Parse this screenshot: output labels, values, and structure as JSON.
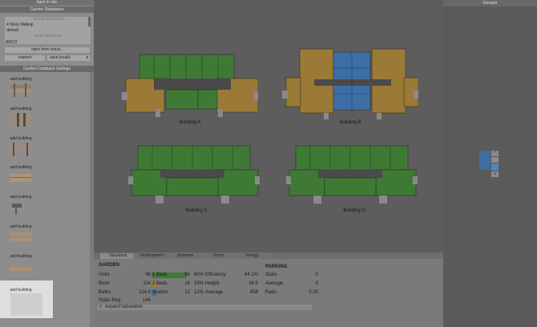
{
  "left_panel": {
    "back_label": "back to site",
    "garden_db_header": "Garden Databases",
    "databases": [
      "default databases",
      "4 Story Walkup",
      "default",
      "local databases"
    ],
    "arco_label": "ARCO",
    "open_cloud_label": "open from cloud...",
    "name_placeholder": "<name>",
    "save_select_value": "save locally",
    "settings_header": "Garden Database Settings",
    "tiles": [
      "add building",
      "add building",
      "add building",
      "add building",
      "add building",
      "add building",
      "add building"
    ],
    "add_big_label": "add building"
  },
  "canvas": {
    "buildings": [
      {
        "label": "Building A"
      },
      {
        "label": "Building B"
      },
      {
        "label": "Building C"
      },
      {
        "label": "Building D"
      }
    ]
  },
  "elevator": {
    "title": "Elevator",
    "up_symbol": "^",
    "down_symbol": "v"
  },
  "bottom": {
    "tabs": [
      "Tabulation",
      "Development",
      "Schemes",
      "Errors",
      "Energy"
    ],
    "garden_header": "GARDEN",
    "parking_header": "PARKING",
    "rows": [
      {
        "label": "Units",
        "value": "96",
        "mix_label": "1 Beds",
        "mix_value": "66",
        "pct": "69%",
        "metric": "Efficiency",
        "metric_value": "84.1%"
      },
      {
        "label": "Beds",
        "value": "114",
        "mix_label": "2 Beds",
        "mix_value": "18",
        "pct": "19%",
        "metric": "Height",
        "metric_value": "34.5"
      },
      {
        "label": "Baths",
        "value": "114.0",
        "mix_label": "Studios",
        "mix_value": "12",
        "pct": "12%",
        "metric": "Average",
        "metric_value": "858"
      },
      {
        "label": "Stalls Req.",
        "value": "144"
      }
    ],
    "parking_rows": [
      {
        "label": "Stalls",
        "value": "0"
      },
      {
        "label": "Average",
        "value": "0"
      },
      {
        "label": "Ratio",
        "value": "0.00"
      }
    ],
    "expand_label": "expand tabulation",
    "colors": {
      "green": "#3f7a34",
      "gold": "#9a7a36",
      "blue": "#3d6fa6"
    }
  }
}
